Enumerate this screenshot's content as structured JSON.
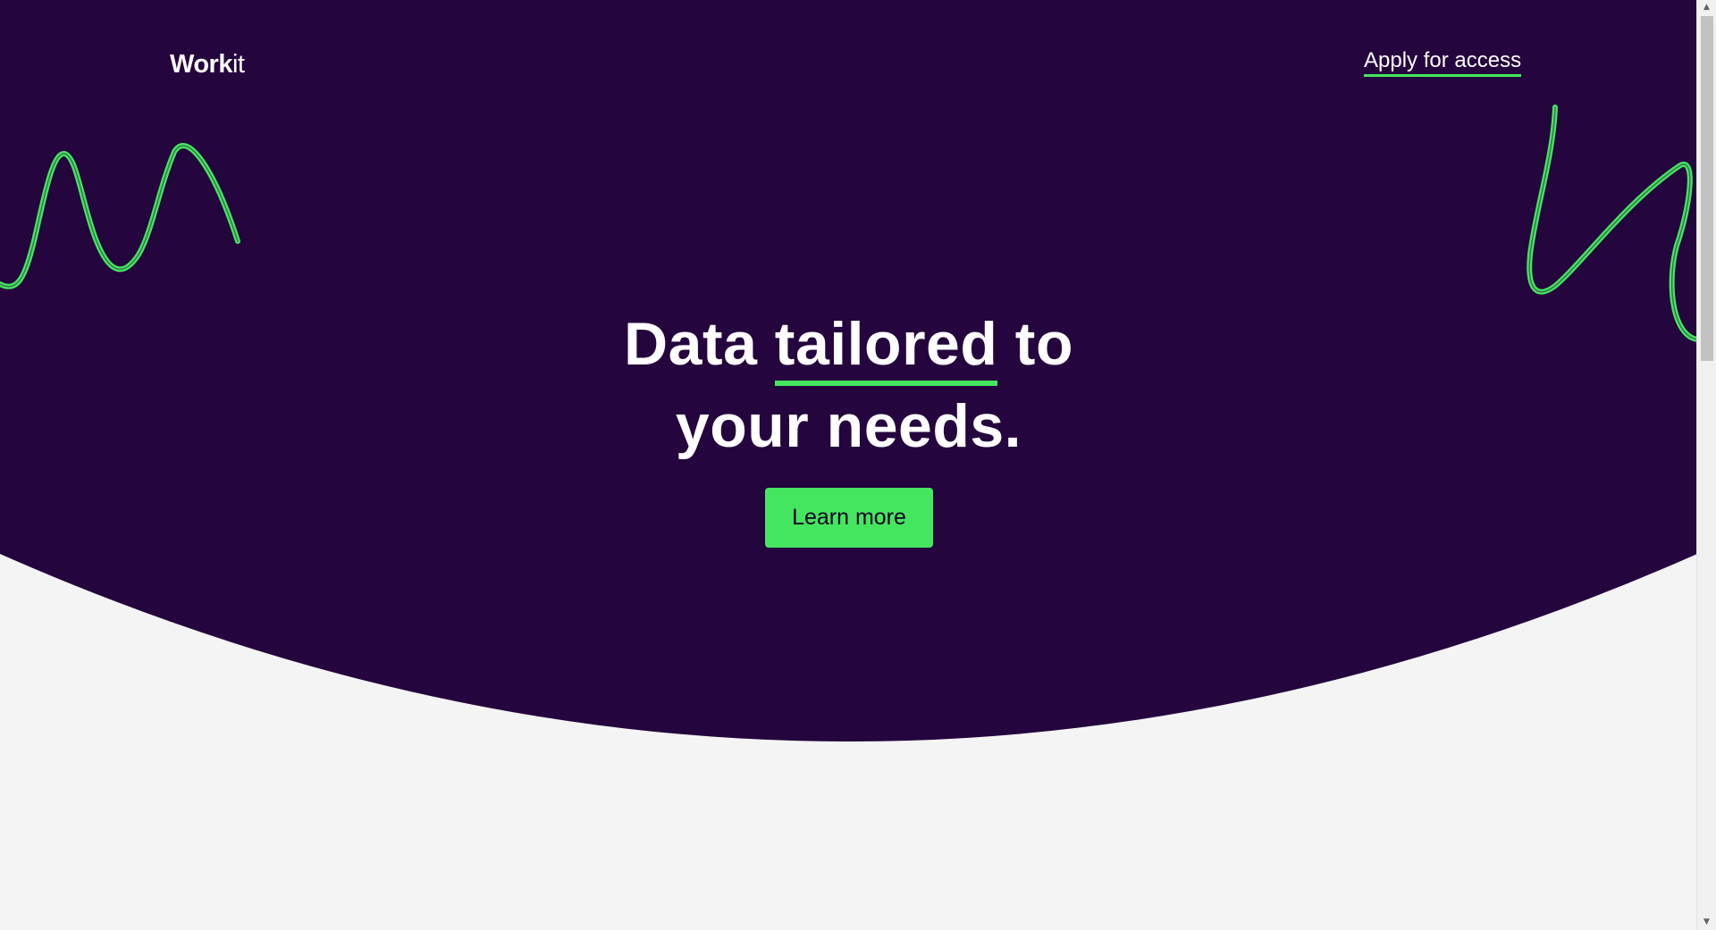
{
  "brand": {
    "logo_bold": "Work",
    "logo_light": "it"
  },
  "nav": {
    "apply_label": "Apply for access"
  },
  "hero": {
    "headline_part1": "Data ",
    "headline_emphasis": "tailored",
    "headline_part2": " to",
    "headline_line2": "your needs.",
    "cta_label": "Learn more"
  },
  "colors": {
    "hero_background": "#24053d",
    "accent_green": "#45e65f",
    "page_background": "#f4f4f4",
    "text_white": "#ffffff"
  },
  "icons": {
    "left_decoration": "squiggle-line-icon",
    "right_decoration": "squiggle-line-icon"
  }
}
